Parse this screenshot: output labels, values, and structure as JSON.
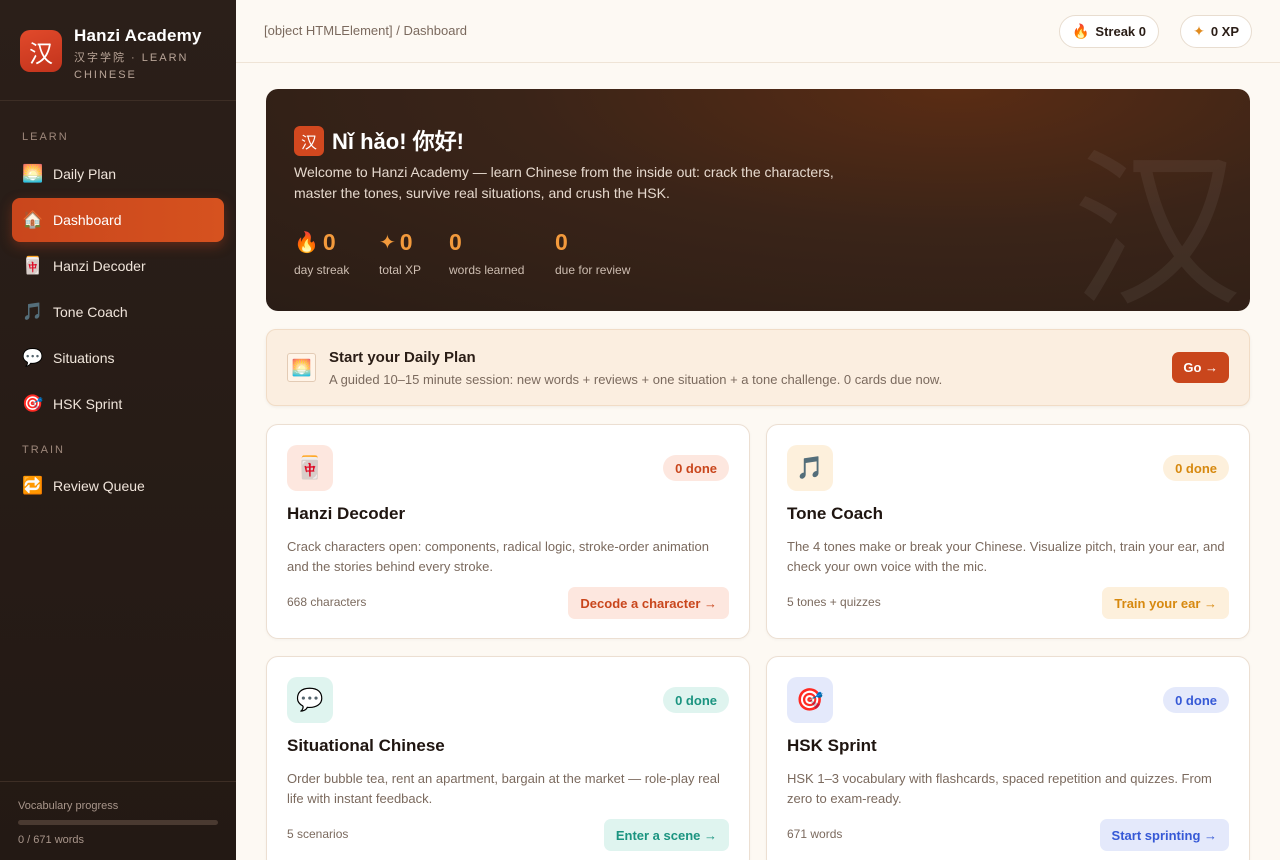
{
  "brand": {
    "logo_char": "汉",
    "title": "Hanzi Academy",
    "subtitle": "汉字学院 · LEARN CHINESE"
  },
  "sidebar": {
    "sections": {
      "learn": "LEARN",
      "train": "TRAIN"
    },
    "items": [
      {
        "label": "Daily Plan",
        "icon": "🌅",
        "icon_name": "sunrise-icon"
      },
      {
        "label": "Dashboard",
        "icon": "🏠",
        "icon_name": "house-icon",
        "active": true
      },
      {
        "label": "Hanzi Decoder",
        "icon": "🀄",
        "icon_name": "mahjong-icon"
      },
      {
        "label": "Tone Coach",
        "icon": "🎵",
        "icon_name": "music-note-icon"
      },
      {
        "label": "Situations",
        "icon": "💬",
        "icon_name": "speech-bubble-icon"
      },
      {
        "label": "HSK Sprint",
        "icon": "🎯",
        "icon_name": "target-icon"
      },
      {
        "label": "Review Queue",
        "icon": "🔁",
        "icon_name": "repeat-icon"
      }
    ],
    "vocab": {
      "label": "Vocabulary progress",
      "count": "0 / 671 words",
      "progress": 0
    }
  },
  "topbar": {
    "breadcrumb": "[object HTMLElement] / Dashboard",
    "streak": {
      "icon": "🔥",
      "label": "Streak 0"
    },
    "xp": {
      "icon": "✦",
      "label": "0 XP"
    }
  },
  "hero": {
    "badge": "汉",
    "title": "Nǐ hǎo! 你好!",
    "description": "Welcome to Hanzi Academy — learn Chinese from the inside out: crack the characters, master the tones, survive real situations, and crush the HSK.",
    "watermark": "汉",
    "stats": [
      {
        "icon": "🔥",
        "value": "0",
        "label": "day streak"
      },
      {
        "icon": "✦",
        "value": "0",
        "label": "total XP"
      },
      {
        "icon": "",
        "value": "0",
        "label": "words learned"
      },
      {
        "icon": "",
        "value": "0",
        "label": "due for review"
      }
    ]
  },
  "plan": {
    "icon": "🌅",
    "title": "Start your Daily Plan",
    "description": "A guided 10–15 minute session: new words + reviews + one situation + a tone challenge. 0 cards due now.",
    "button": "Go →"
  },
  "cards": [
    {
      "icon": "🀄",
      "badge": "0 done",
      "title": "Hanzi Decoder",
      "description": "Crack characters open: components, radical logic, stroke-order animation and the stories behind every stroke.",
      "meta": "668 characters",
      "cta": "Decode a character →"
    },
    {
      "icon": "🎵",
      "badge": "0 done",
      "title": "Tone Coach",
      "description": "The 4 tones make or break your Chinese. Visualize pitch, train your ear, and check your own voice with the mic.",
      "meta": "5 tones + quizzes",
      "cta": "Train your ear →"
    },
    {
      "icon": "💬",
      "badge": "0 done",
      "title": "Situational Chinese",
      "description": "Order bubble tea, rent an apartment, bargain at the market — role-play real life with instant feedback.",
      "meta": "5 scenarios",
      "cta": "Enter a scene →"
    },
    {
      "icon": "🎯",
      "badge": "0 done",
      "title": "HSK Sprint",
      "description": "HSK 1–3 vocabulary with flashcards, spaced repetition and quizzes. From zero to exam-ready.",
      "meta": "671 words",
      "cta": "Start sprinting →"
    }
  ],
  "colors": {
    "accent": "#c9461c",
    "sidebar_bg": "#2b1f19",
    "hero_stat": "#f39a3c",
    "amber": "#d7890f",
    "teal": "#1b9480",
    "blue": "#3659d6"
  }
}
